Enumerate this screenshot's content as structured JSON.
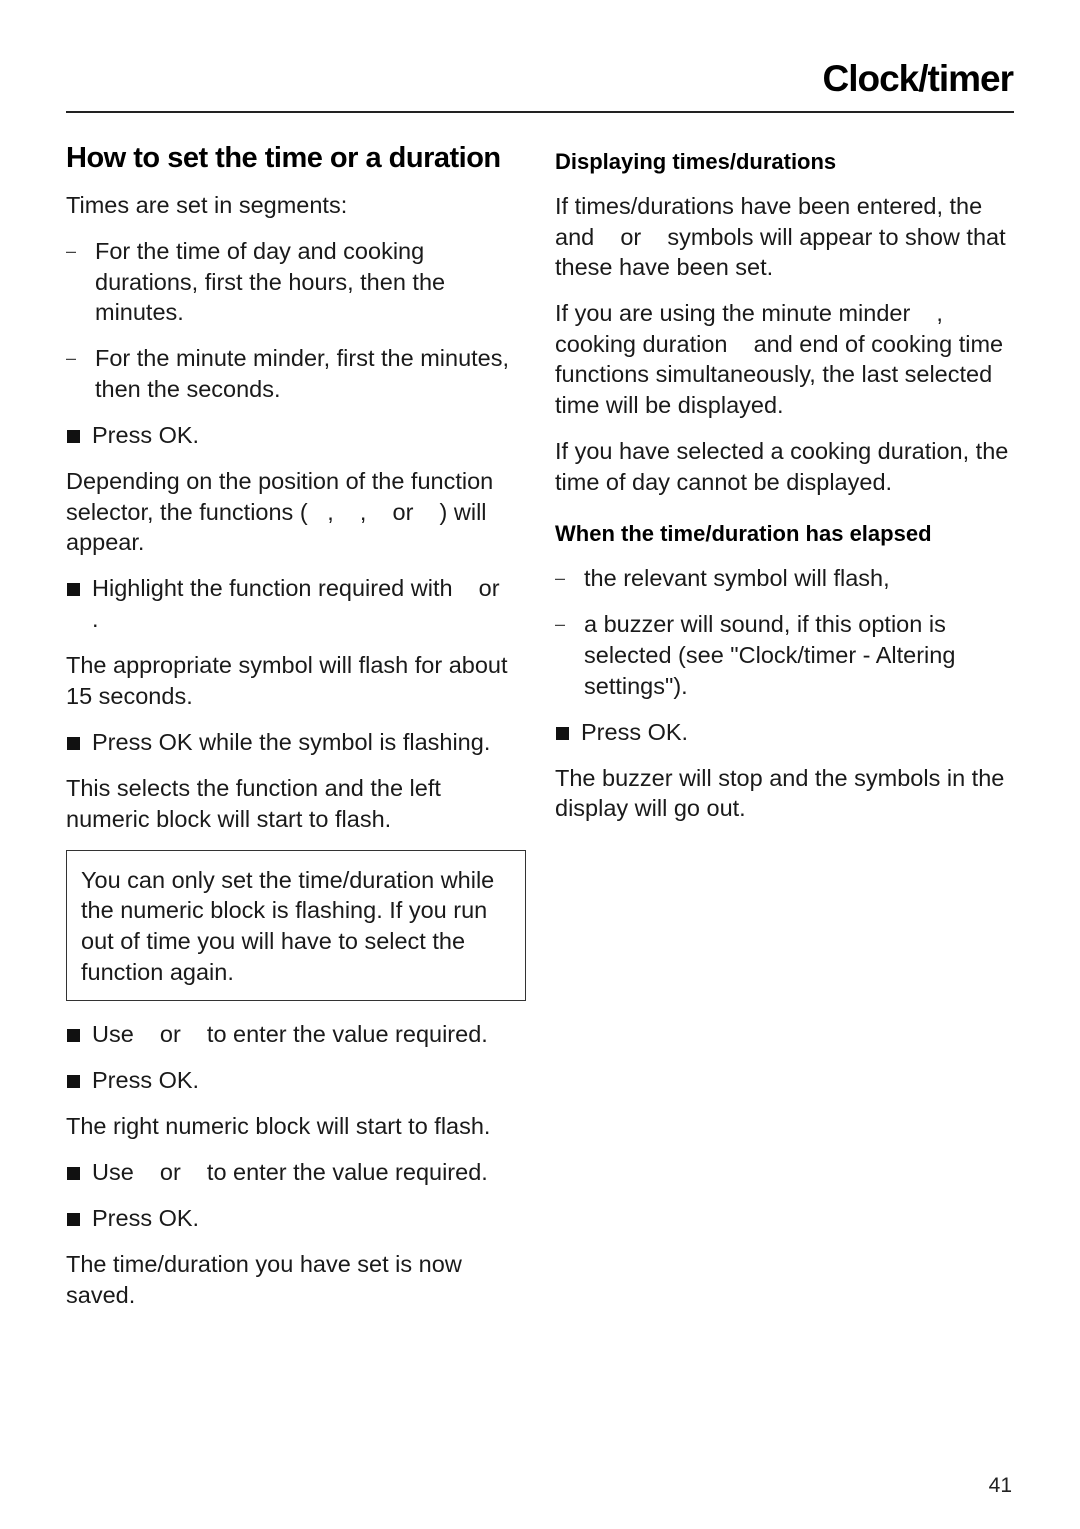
{
  "header": {
    "section_title": "Clock/timer"
  },
  "left_column": {
    "heading": "How to set the time or a duration",
    "intro": "Times are set in segments:",
    "segments": [
      "For the time of day and cooking durations, first the hours, then the minutes.",
      "For the minute minder, first the minutes, then the seconds."
    ],
    "step_press_ok_1": "Press OK.",
    "function_selector_text": "Depending on the position of the function selector, the functions (   ,    ,    or    ) will appear.",
    "step_highlight": "Highlight the function required with    or    .",
    "flash_info": "The appropriate symbol will flash for about 15 seconds.",
    "step_press_ok_flashing": "Press OK while the symbol is flashing.",
    "selects_text": "This selects the function and the left numeric block will start to flash.",
    "note": "You can only set the time/duration while the numeric block is flashing. If you run out of time you will have to select the function again.",
    "step_use_1": "Use    or    to enter the value required.",
    "step_press_ok_2": "Press OK.",
    "right_block_text": "The right numeric block will start to flash.",
    "step_use_2": "Use    or    to enter the value required.",
    "step_press_ok_3": "Press OK.",
    "saved_text": "The time/duration you have set is now saved."
  },
  "right_column": {
    "displaying": {
      "heading": "Displaying times/durations",
      "para1": "If times/durations have been entered, the    and    or    symbols will appear to show that these have been set.",
      "para2": "If you are using the minute minder    , cooking duration    and end of cooking time    functions simultaneously, the last selected time will be displayed.",
      "para3": "If you have selected a cooking duration, the time of day cannot be displayed."
    },
    "elapsed": {
      "heading": "When the time/duration has elapsed",
      "items": [
        "the relevant symbol will flash,",
        "a buzzer will sound, if this option is selected (see \"Clock/timer - Altering settings\")."
      ],
      "step_press_ok": "Press OK.",
      "result": "The buzzer will stop and the symbols in the display will go out."
    }
  },
  "footer": {
    "page_number": "41"
  }
}
